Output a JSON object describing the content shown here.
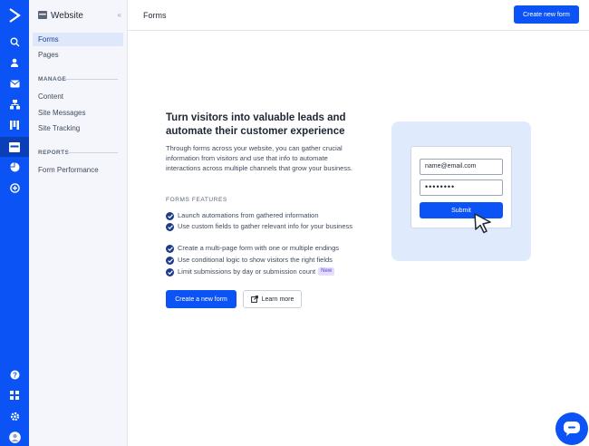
{
  "rail": {
    "icons": [
      "logo-icon",
      "search-icon",
      "contacts-icon",
      "campaigns-icon",
      "automations-icon",
      "deals-icon",
      "website-icon",
      "reports-icon",
      "conversations-icon",
      "help-icon",
      "apps-icon",
      "settings-icon",
      "account-icon"
    ]
  },
  "sidebar": {
    "title": "Website",
    "items_top": [
      {
        "label": "Forms"
      },
      {
        "label": "Pages"
      }
    ],
    "manage_label": "MANAGE",
    "manage_items": [
      {
        "label": "Content"
      },
      {
        "label": "Site Messages"
      },
      {
        "label": "Site Tracking"
      }
    ],
    "reports_label": "REPORTS",
    "reports_items": [
      {
        "label": "Form Performance"
      }
    ]
  },
  "header": {
    "title": "Forms",
    "create_button": "Create new form"
  },
  "empty_state": {
    "heading": "Turn visitors into valuable leads and automate their customer experience",
    "description": "Through forms across your website, you can gather crucial information from visitors and use that info to automate interactions across multiple channels that grow your business.",
    "features_label": "FORMS FEATURES",
    "features": [
      "Launch automations from gathered information",
      "Use custom fields to gather relevant info for your business",
      "Create a multi-page form with one or multiple endings",
      "Use conditional logic to show visitors the right fields",
      "Limit submissions by day or submission count"
    ],
    "new_badge": "New",
    "create_button": "Create a new form",
    "learn_button": "Learn more"
  },
  "illustration": {
    "email_value": "name@email.com",
    "password_value": "••••••••",
    "submit_label": "Submit"
  },
  "colors": {
    "brand": "#0b53f4",
    "rail_active": "#0a3fb8",
    "check": "#1f3a8a",
    "illustration_bg": "#dfeafd"
  }
}
